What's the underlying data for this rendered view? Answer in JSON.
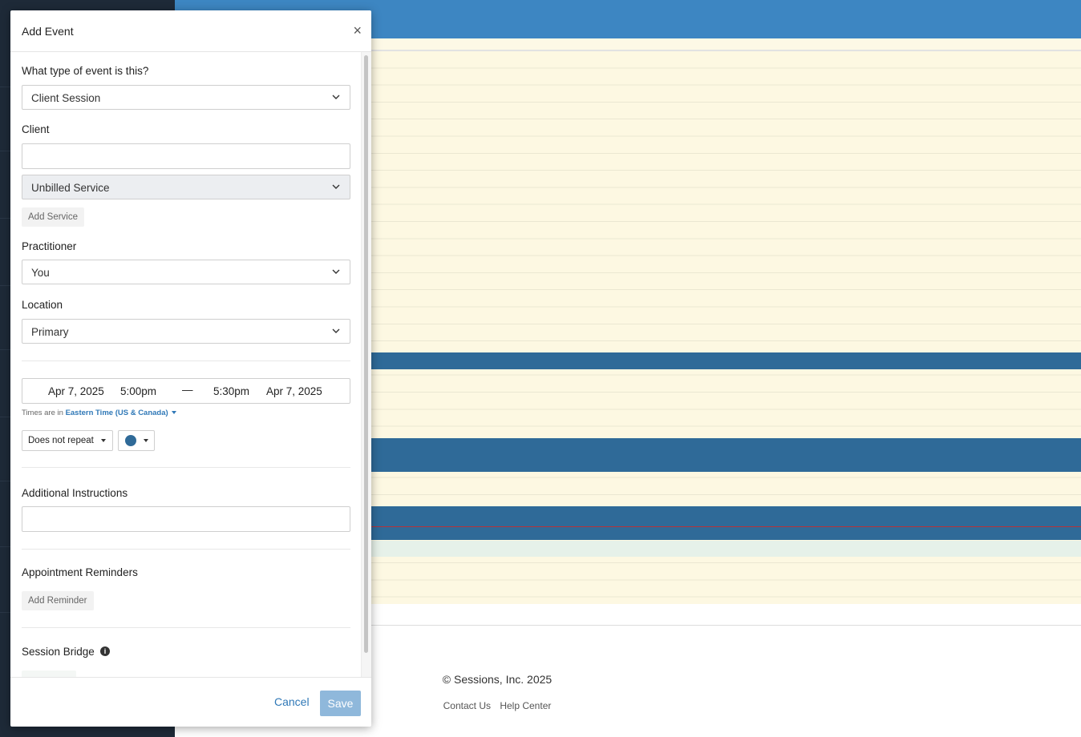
{
  "modal": {
    "title": "Add Event",
    "close_symbol": "×",
    "event_type": {
      "label": "What type of event is this?",
      "value": "Client Session"
    },
    "client": {
      "label": "Client",
      "value": "",
      "service": "Unbilled Service",
      "add_service": "Add Service"
    },
    "practitioner": {
      "label": "Practitioner",
      "value": "You"
    },
    "location": {
      "label": "Location",
      "value": "Primary"
    },
    "datetime": {
      "start_date": "Apr 7, 2025",
      "start_time": "5:00pm",
      "separator": "—",
      "end_time": "5:30pm",
      "end_date": "Apr 7, 2025",
      "tz_prefix": "Times are in",
      "tz_name": "Eastern Time (US & Canada)"
    },
    "repeat": "Does not repeat",
    "event_color": "#2f6a98",
    "additional_instructions": {
      "label": "Additional Instructions",
      "value": ""
    },
    "reminders": {
      "label": "Appointment Reminders",
      "add": "Add Reminder"
    },
    "session_bridge": {
      "label": "Session Bridge",
      "info_icon": "info-icon"
    },
    "footer": {
      "cancel": "Cancel",
      "save": "Save"
    }
  },
  "page_footer": {
    "copyright": "© Sessions, Inc. 2025",
    "links": [
      "Contact Us",
      "Help Center"
    ]
  },
  "colors": {
    "calendar_header": "#3d86c2",
    "event_block": "#2f6a98",
    "grid_background": "#fdf8e2",
    "now_line": "#b5323a",
    "link": "#2f78b7"
  }
}
